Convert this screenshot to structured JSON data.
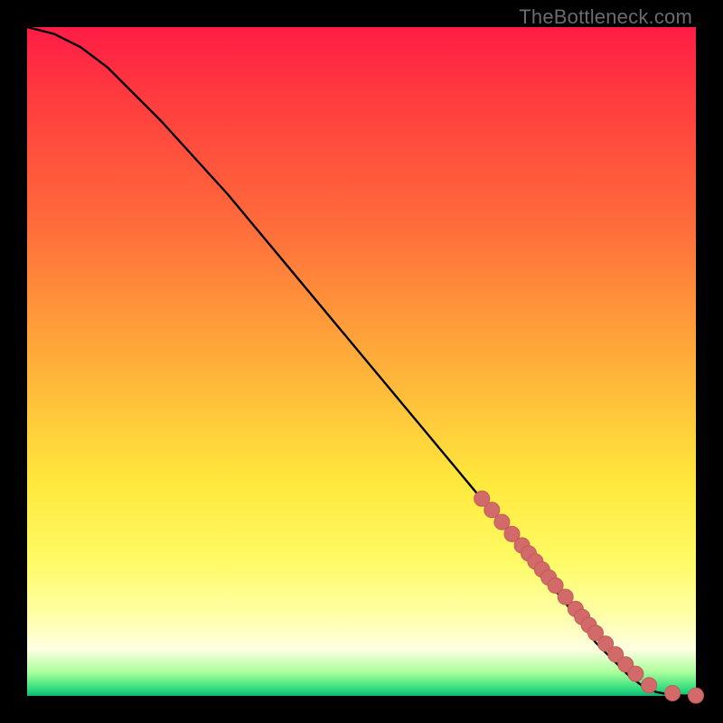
{
  "watermark": "TheBottleneck.com",
  "colors": {
    "curve": "#000000",
    "marker_fill": "#d26a6a",
    "marker_stroke": "#c45a5a",
    "frame_bg": "#000000"
  },
  "chart_data": {
    "type": "line",
    "title": "",
    "xlabel": "",
    "ylabel": "",
    "xlim": [
      0,
      100
    ],
    "ylim": [
      0,
      100
    ],
    "grid": false,
    "series": [
      {
        "name": "curve",
        "x": [
          0,
          4,
          8,
          12,
          16,
          20,
          30,
          40,
          50,
          60,
          70,
          78,
          82,
          85,
          88,
          90,
          92,
          94,
          96,
          98,
          100
        ],
        "y": [
          100,
          99,
          97,
          94,
          90,
          86,
          75,
          63,
          51,
          39,
          27,
          17,
          12,
          8,
          5,
          3,
          1.5,
          0.6,
          0.2,
          0.05,
          0
        ]
      }
    ],
    "markers": {
      "name": "highlighted-points",
      "x": [
        68,
        69.5,
        71,
        72.5,
        74,
        75,
        76,
        77,
        78,
        79,
        80.5,
        82,
        83,
        84,
        85,
        86.5,
        88,
        89.5,
        91,
        93,
        96.5,
        100
      ],
      "y": [
        29.5,
        27.8,
        26.0,
        24.2,
        22.5,
        21.3,
        20.1,
        18.9,
        17.7,
        16.5,
        14.8,
        13.0,
        11.8,
        10.6,
        9.4,
        7.8,
        6.2,
        4.7,
        3.3,
        1.6,
        0.4,
        0.05
      ]
    }
  }
}
